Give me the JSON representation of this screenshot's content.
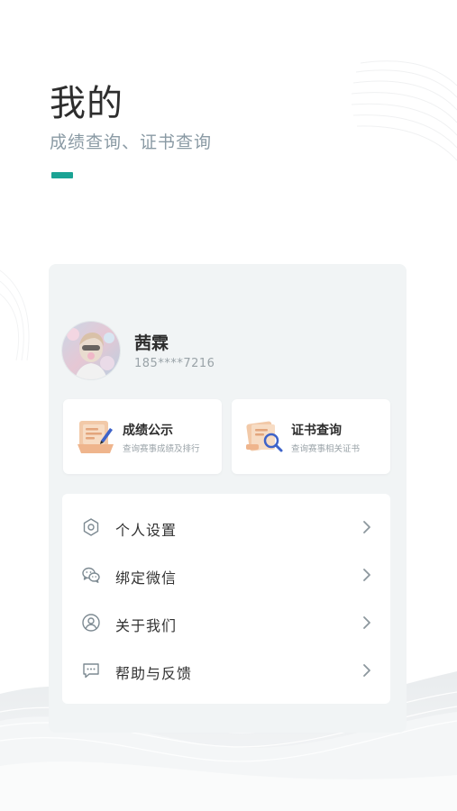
{
  "header": {
    "title": "我的",
    "subtitle": "成绩查询、证书查询"
  },
  "user": {
    "name": "茜霖",
    "phone": "185****7216"
  },
  "quick_actions": [
    {
      "title": "成绩公示",
      "subtitle": "查询赛事成绩及排行",
      "icon": "score-board-icon"
    },
    {
      "title": "证书查询",
      "subtitle": "查询赛事相关证书",
      "icon": "certificate-search-icon"
    }
  ],
  "menu": [
    {
      "label": "个人设置",
      "icon": "settings-icon"
    },
    {
      "label": "绑定微信",
      "icon": "wechat-icon"
    },
    {
      "label": "关于我们",
      "icon": "user-circle-icon"
    },
    {
      "label": "帮助与反馈",
      "icon": "chat-bubble-icon"
    }
  ],
  "colors": {
    "accent": "#1aa394",
    "card_bg": "#f1f4f5",
    "subtitle": "#8a9aa4"
  }
}
